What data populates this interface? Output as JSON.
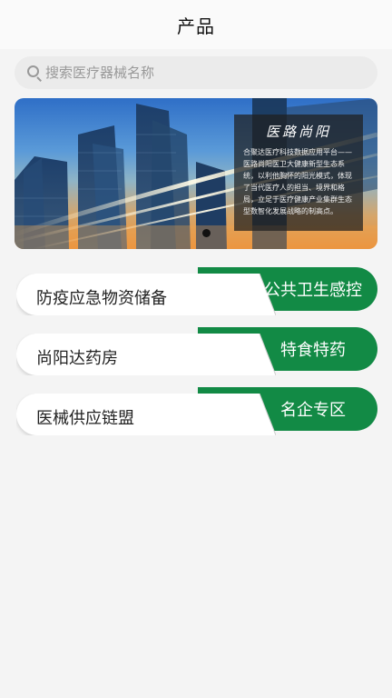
{
  "header": {
    "title": "产品"
  },
  "search": {
    "placeholder": "搜索医疗器械名称"
  },
  "banner": {
    "panel_title": "医路尚阳",
    "panel_text": "合聚达医疗科技数据应用平台——医路尚阳医卫大健康新型生态系统，以利他胸怀的阳光模式，体现了当代医疗人的担当、境界和格局，立足于医疗健康产业集群生态型数智化发展战略的制高点。",
    "active_dot": 0
  },
  "categories": [
    {
      "left_label": "防疫应急物资储备",
      "right_label": "公共卫生感控"
    },
    {
      "left_label": "尚阳达药房",
      "right_label": "特食特药"
    },
    {
      "left_label": "医械供应链盟",
      "right_label": "名企专区"
    }
  ]
}
